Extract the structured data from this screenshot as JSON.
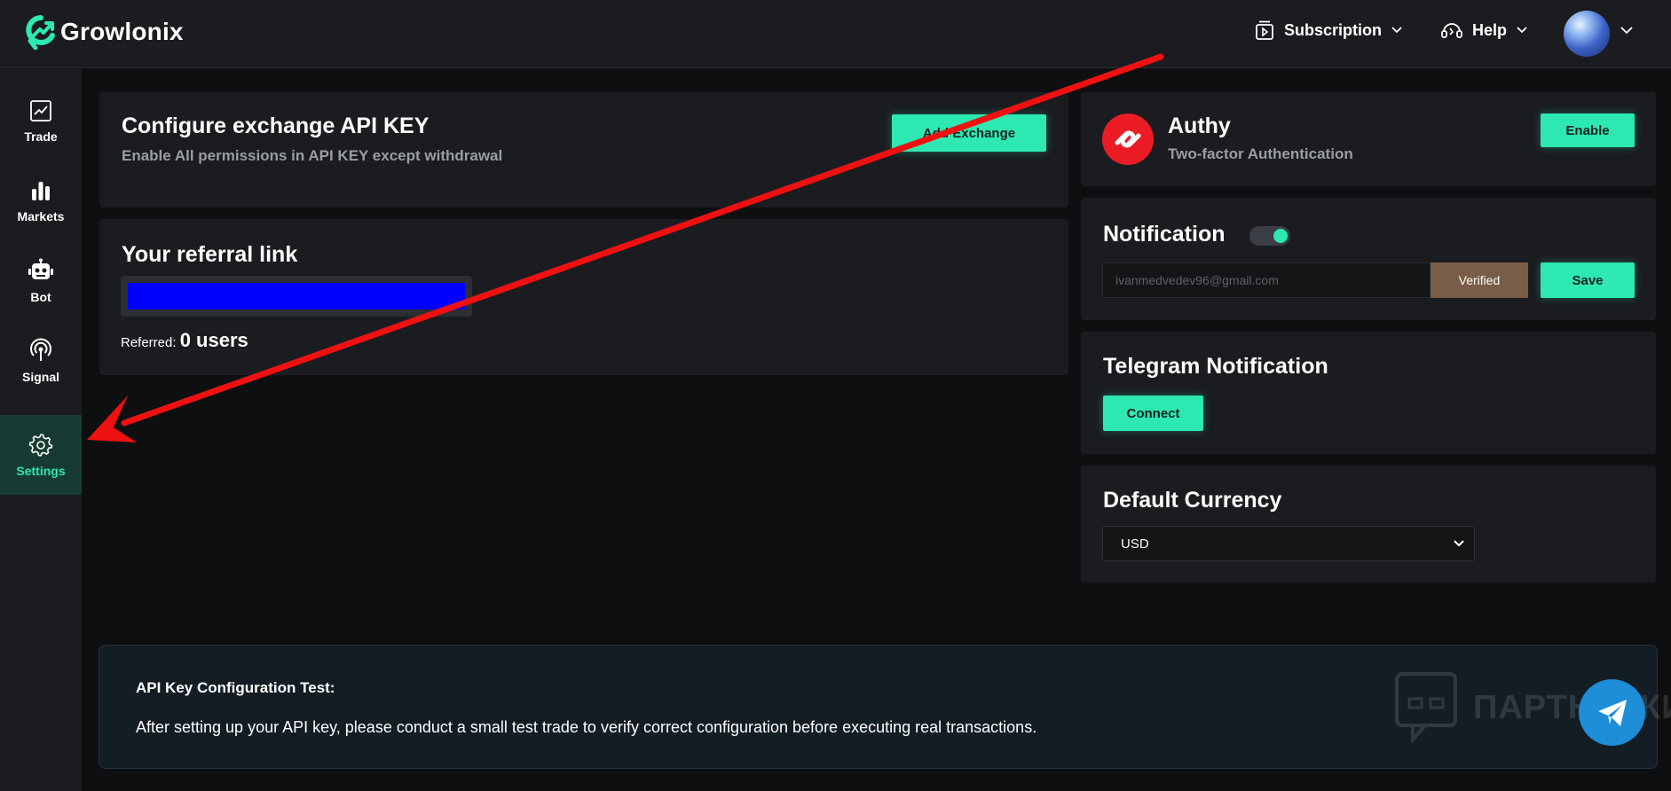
{
  "app": {
    "name": "Growlonix"
  },
  "header": {
    "subscription_label": "Subscription",
    "help_label": "Help"
  },
  "sidebar": {
    "items": [
      {
        "label": "Trade",
        "icon": "chart-line-icon"
      },
      {
        "label": "Markets",
        "icon": "bar-chart-icon"
      },
      {
        "label": "Bot",
        "icon": "robot-icon"
      },
      {
        "label": "Signal",
        "icon": "signal-icon"
      },
      {
        "label": "Settings",
        "icon": "gear-icon",
        "active": true
      }
    ]
  },
  "exchange": {
    "title": "Configure exchange API KEY",
    "subtitle": "Enable All permissions in API KEY except withdrawal",
    "button_label": "Add Exchange"
  },
  "referral": {
    "title": "Your referral link",
    "referred_label": "Referred:",
    "referred_count": "0 users"
  },
  "authy": {
    "title": "Authy",
    "subtitle": "Two-factor Authentication",
    "button_label": "Enable"
  },
  "notification": {
    "title": "Notification",
    "email_value": "ivanmedvedev96@gmail.com",
    "status_label": "Verified",
    "save_label": "Save",
    "enabled": true
  },
  "telegram": {
    "title": "Telegram Notification",
    "button_label": "Connect"
  },
  "currency": {
    "title": "Default Currency",
    "selected": "USD"
  },
  "info": {
    "title": "API Key Configuration Test:",
    "text": "After setting up your API key, please conduct a small test trade to verify correct configuration before executing real transactions.",
    "watermark": "ПАРТНЕРКИН"
  },
  "colors": {
    "accent": "#2ee8b2",
    "background": "#0e0f10",
    "card": "#1a1c20",
    "verified": "#7a5d48",
    "telegram": "#1e8ed8",
    "annotation_arrow": "#ee1111"
  }
}
